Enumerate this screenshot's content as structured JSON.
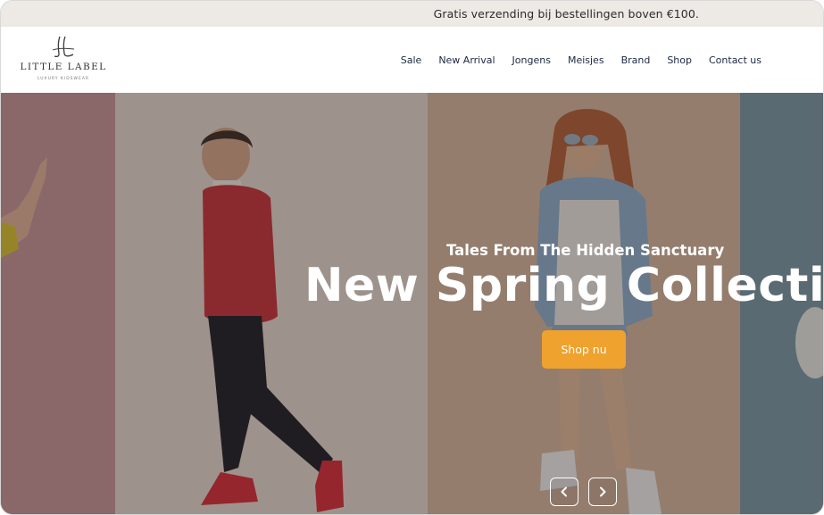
{
  "announcement": {
    "text": "Gratis verzending bij bestellingen boven €100."
  },
  "brand": {
    "name": "LITTLE LABEL",
    "tagline": "LUXURY KIDSWEAR",
    "logo_icon": "ll-monogram-icon"
  },
  "nav": {
    "items": [
      {
        "label": "Sale"
      },
      {
        "label": "New Arrival"
      },
      {
        "label": "Jongens"
      },
      {
        "label": "Meisjes"
      },
      {
        "label": "Brand"
      },
      {
        "label": "Shop"
      },
      {
        "label": "Contact us"
      }
    ]
  },
  "hero": {
    "eyebrow": "Tales From The Hidden Sanctuary",
    "title": "New Spring Collection",
    "cta_label": "Shop nu",
    "prev_icon": "chevron-left-icon",
    "next_icon": "chevron-right-icon"
  },
  "colors": {
    "accent": "#efa22d",
    "nav_text": "#1c2740",
    "announcement_bg": "#ede9e5"
  }
}
